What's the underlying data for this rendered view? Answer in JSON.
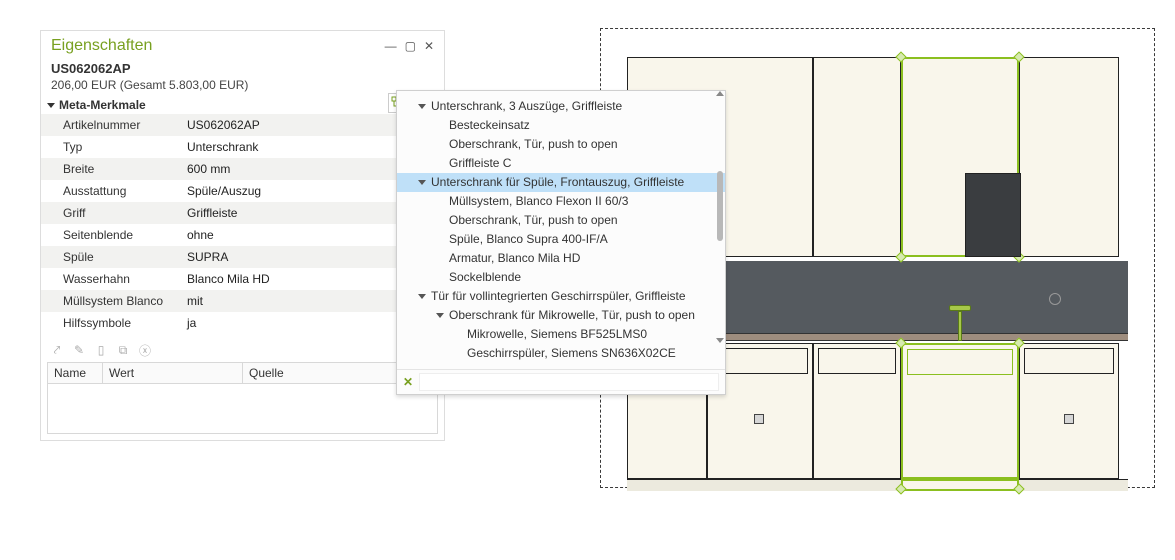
{
  "panel": {
    "title": "Eigenschaften",
    "item_code": "US062062AP",
    "price_line": "206,00 EUR (Gesamt 5.803,00 EUR)",
    "section": "Meta-Merkmale",
    "rows": [
      {
        "label": "Artikelnummer",
        "value": "US062062AP"
      },
      {
        "label": "Typ",
        "value": "Unterschrank"
      },
      {
        "label": "Breite",
        "value": "600 mm"
      },
      {
        "label": "Ausstattung",
        "value": "Spüle/Auszug"
      },
      {
        "label": "Griff",
        "value": "Griffleiste"
      },
      {
        "label": "Seitenblende",
        "value": "ohne"
      },
      {
        "label": "Spüle",
        "value": "SUPRA"
      },
      {
        "label": "Wasserhahn",
        "value": "Blanco Mila HD"
      },
      {
        "label": "Müllsystem Blanco",
        "value": "mit"
      },
      {
        "label": "Hilfssymbole",
        "value": "ja"
      }
    ],
    "subcols": {
      "name": "Name",
      "wert": "Wert",
      "quelle": "Quelle"
    }
  },
  "tree": {
    "items": [
      {
        "depth": 0,
        "expander": "down",
        "label": "Unterschrank, 3 Auszüge, Griffleiste"
      },
      {
        "depth": 1,
        "expander": "",
        "label": "Besteckeinsatz"
      },
      {
        "depth": 1,
        "expander": "",
        "label": "Oberschrank, Tür, push to open"
      },
      {
        "depth": 1,
        "expander": "",
        "label": "Griffleiste C"
      },
      {
        "depth": 0,
        "expander": "down",
        "label": "Unterschrank für Spüle, Frontauszug, Griffleiste",
        "selected": true
      },
      {
        "depth": 1,
        "expander": "",
        "label": "Müllsystem, Blanco Flexon II 60/3"
      },
      {
        "depth": 1,
        "expander": "",
        "label": "Oberschrank, Tür, push to open"
      },
      {
        "depth": 1,
        "expander": "",
        "label": "Spüle, Blanco Supra 400-IF/A"
      },
      {
        "depth": 1,
        "expander": "",
        "label": "Armatur, Blanco Mila HD"
      },
      {
        "depth": 1,
        "expander": "",
        "label": "Sockelblende"
      },
      {
        "depth": 0,
        "expander": "down",
        "label": "Tür für vollintegrierten Geschirrspüler, Griffleiste"
      },
      {
        "depth": 1,
        "expander": "down",
        "label": "Oberschrank für Mikrowelle, Tür, push to open"
      },
      {
        "depth": 2,
        "expander": "",
        "label": "Mikrowelle, Siemens BF525LMS0"
      },
      {
        "depth": 2,
        "expander": "",
        "label": "Geschirrspüler, Siemens SN636X02CE"
      }
    ]
  }
}
